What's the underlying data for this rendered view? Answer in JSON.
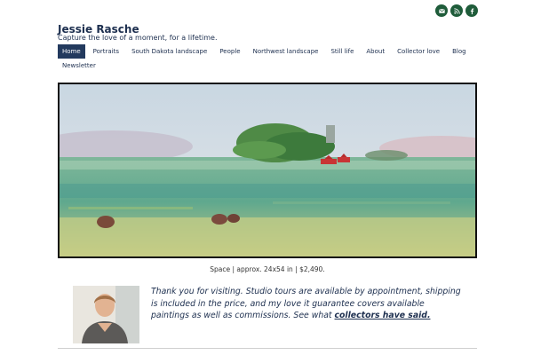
{
  "site": {
    "title": "Jessie Rasche",
    "tagline": "Capture the love of a moment, for a lifetime."
  },
  "social": {
    "icons": [
      "envelope-icon",
      "rss-icon",
      "facebook-icon"
    ],
    "color": "#1f5c3a"
  },
  "nav": {
    "items": [
      "Home",
      "Portraits",
      "South Dakota landscape",
      "People",
      "Northwest landscape",
      "Still life",
      "About",
      "Collector love",
      "Blog",
      "Newsletter"
    ],
    "active": "Home",
    "active_color": "#233a5e"
  },
  "hero": {
    "caption": "Space | approx. 24x54 in | $2,490."
  },
  "intro": {
    "text": "Thank you for visiting. Studio tours are available by appointment, shipping is included in the price, and my love it guarantee covers available paintings as well as commissions. See what ",
    "link_text": "collectors have said."
  },
  "colors": {
    "title": "#1d2f4f"
  }
}
